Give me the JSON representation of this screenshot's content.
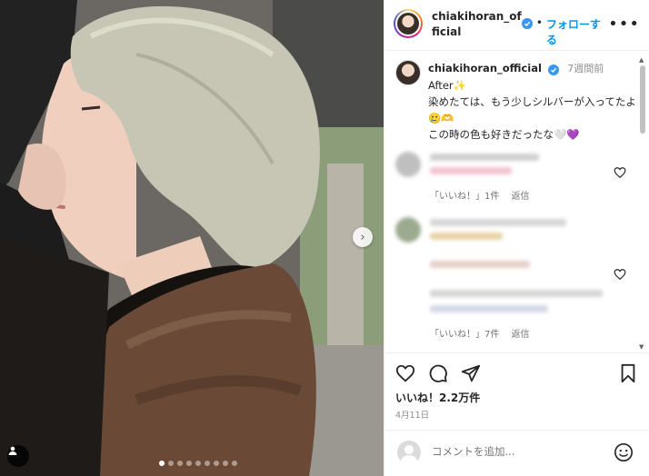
{
  "post": {
    "username": "chiakihoran_official",
    "header_dot": "•",
    "follow_label": "フォローする",
    "more_label": "•••",
    "caption_time": "7週間前",
    "caption_lines": [
      "After✨",
      "染めたては、もう少しシルバーが入ってたよ🥲🫶",
      "この時の色も好きだったな🤍💜"
    ],
    "comments": [
      {
        "like_label": "「いいね！」1件",
        "reply_label": "返信"
      },
      {
        "like_label": "「いいね！」7件",
        "reply_label": "返信"
      }
    ],
    "likes_text": "いいね！2.2万件",
    "date_text": "4月11日",
    "comment_placeholder": "コメントを追加...",
    "carousel": {
      "total_slides": 9,
      "active_index": 0
    }
  },
  "colors": {
    "accent": "#0095f6",
    "verified": "#3897f0",
    "text": "#262626",
    "muted": "#8e8e8e"
  },
  "icons": [
    "verified-badge-icon",
    "heart-icon",
    "comment-icon",
    "share-icon",
    "bookmark-icon",
    "emoji-icon",
    "next-arrow-icon",
    "user-tag-icon"
  ]
}
